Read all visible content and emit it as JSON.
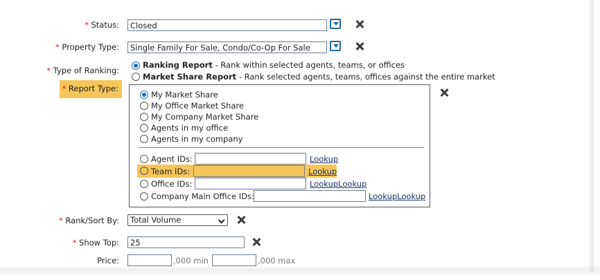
{
  "status": {
    "label": "Status:",
    "value": "Closed"
  },
  "property_type": {
    "label": "Property Type:",
    "value": "Single Family For Sale, Condo/Co-Op For Sale"
  },
  "type_of_ranking": {
    "label": "Type of Ranking:",
    "options": [
      {
        "title": "Ranking Report",
        "desc": " - Rank within selected agents, teams, or offices",
        "selected": true
      },
      {
        "title": "Market Share Report",
        "desc": " - Rank selected agents, teams, offices against the entire market",
        "selected": false
      }
    ]
  },
  "report_type": {
    "label": "Report Type:",
    "options": [
      {
        "label": "My Market Share",
        "selected": true
      },
      {
        "label": "My Office Market Share",
        "selected": false
      },
      {
        "label": "My Company Market Share",
        "selected": false
      },
      {
        "label": "Agents in my office",
        "selected": false
      },
      {
        "label": "Agents in my company",
        "selected": false
      }
    ],
    "id_options": [
      {
        "label": "Agent IDs:",
        "value": "",
        "link": "Lookup"
      },
      {
        "label": "Team IDs:",
        "value": "",
        "link": "Lookup"
      },
      {
        "label": "Office IDs:",
        "value": "",
        "link": "LookupLookup"
      },
      {
        "label": "Company Main Office IDs:",
        "value": "",
        "link": "LookupLookup"
      }
    ]
  },
  "rank_sort": {
    "label": "Rank/Sort By:",
    "value": "Total Volume"
  },
  "show_top": {
    "label": "Show Top:",
    "value": "25"
  },
  "price": {
    "label": "Price:",
    "min_suffix": ",000 min",
    "max_suffix": ",000 max",
    "min_value": "",
    "max_value": ""
  },
  "required_marker": "*",
  "colors": {
    "highlight": "#f7c65a",
    "accent": "#1f6aa0",
    "required": "#d42020"
  },
  "icons": {
    "dropdown": "dropdown-arrow-icon",
    "clear": "close-x-icon"
  }
}
